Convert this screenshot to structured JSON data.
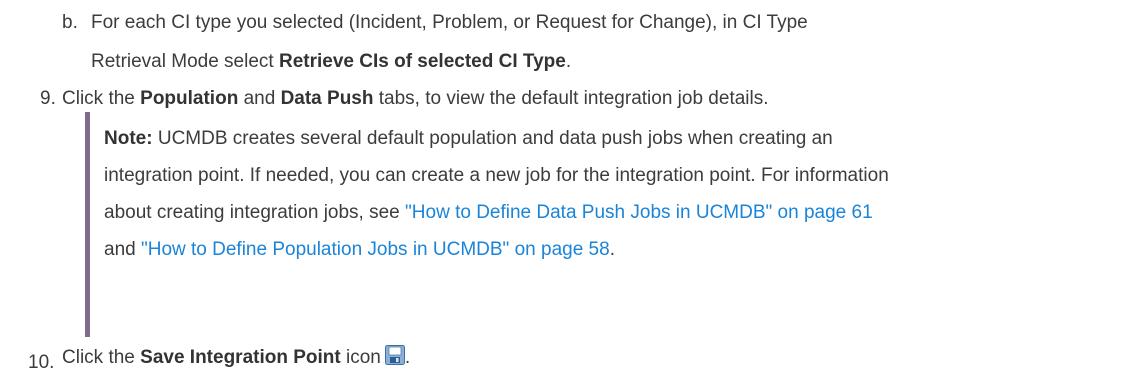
{
  "step_b": {
    "marker": "b.",
    "line1": "For each CI type you selected (Incident, Problem, or Request for Change), in CI Type",
    "line2_prefix": "Retrieval Mode select ",
    "line2_bold": "Retrieve CIs of selected CI Type",
    "line2_suffix": "."
  },
  "step_9": {
    "number": "9.",
    "text_prefix": "Click the ",
    "bold1": "Population",
    "text_and": " and ",
    "bold2": "Data Push",
    "text_suffix": " tabs, to view the default integration job details."
  },
  "note": {
    "label": "Note:",
    "line1": " UCMDB creates several default population and data push jobs when creating an",
    "line2": "integration point. If needed, you can create a new job for the integration point. For information",
    "line3_prefix": "about creating integration jobs, see ",
    "link1": "\"How to Define Data Push Jobs in UCMDB\" on page 61",
    "line4_prefix": "and ",
    "link2": "\"How to Define Population Jobs in UCMDB\" on page 58",
    "line4_suffix": "."
  },
  "step_10": {
    "number": "10.",
    "text_prefix": "Click the ",
    "bold": "Save Integration Point",
    "text_suffix": " icon",
    "end": ".",
    "icon": "save-icon"
  },
  "colors": {
    "link": "#1a84d8",
    "note_bar": "#7f6b8c"
  }
}
